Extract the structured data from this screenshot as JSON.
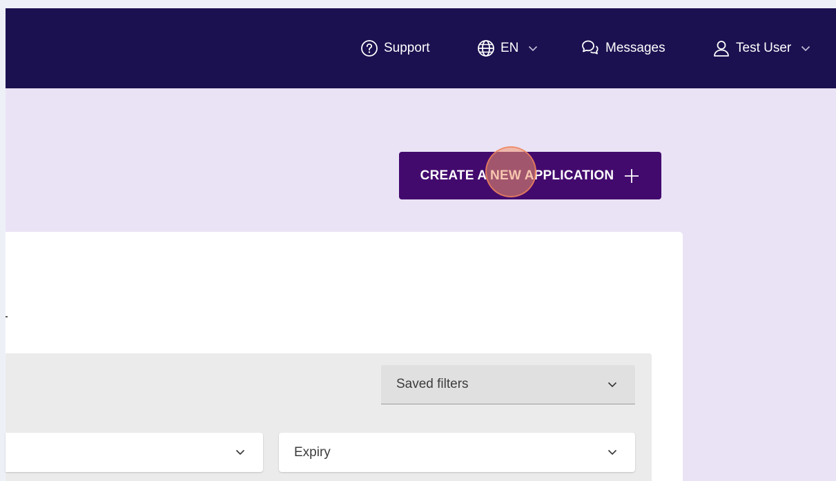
{
  "header": {
    "support_label": "Support",
    "language_label": "EN",
    "messages_label": "Messages",
    "user_label": "Test User"
  },
  "main": {
    "create_button_label": "CREATE A NEW APPLICATION"
  },
  "filters": {
    "saved_filters_label": "Saved filters",
    "first_select_value": "",
    "expiry_label": "Expiry"
  },
  "colors": {
    "header_bg": "#1b1150",
    "page_bg": "#eae3f5",
    "primary_button": "#430a6e",
    "panel_bg": "#ebebeb"
  },
  "icons": {
    "support": "help-circle-icon",
    "language": "globe-icon",
    "messages": "chat-bubbles-icon",
    "user": "user-icon",
    "create": "plus-icon"
  }
}
